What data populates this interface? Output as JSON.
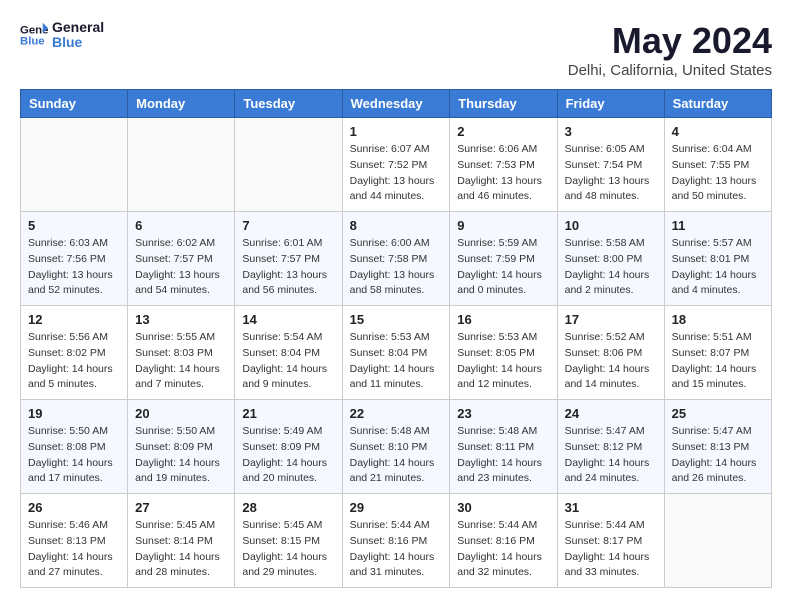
{
  "header": {
    "logo_line1": "General",
    "logo_line2": "Blue",
    "month": "May 2024",
    "location": "Delhi, California, United States"
  },
  "weekdays": [
    "Sunday",
    "Monday",
    "Tuesday",
    "Wednesday",
    "Thursday",
    "Friday",
    "Saturday"
  ],
  "weeks": [
    [
      {
        "day": "",
        "info": ""
      },
      {
        "day": "",
        "info": ""
      },
      {
        "day": "",
        "info": ""
      },
      {
        "day": "1",
        "info": "Sunrise: 6:07 AM\nSunset: 7:52 PM\nDaylight: 13 hours\nand 44 minutes."
      },
      {
        "day": "2",
        "info": "Sunrise: 6:06 AM\nSunset: 7:53 PM\nDaylight: 13 hours\nand 46 minutes."
      },
      {
        "day": "3",
        "info": "Sunrise: 6:05 AM\nSunset: 7:54 PM\nDaylight: 13 hours\nand 48 minutes."
      },
      {
        "day": "4",
        "info": "Sunrise: 6:04 AM\nSunset: 7:55 PM\nDaylight: 13 hours\nand 50 minutes."
      }
    ],
    [
      {
        "day": "5",
        "info": "Sunrise: 6:03 AM\nSunset: 7:56 PM\nDaylight: 13 hours\nand 52 minutes."
      },
      {
        "day": "6",
        "info": "Sunrise: 6:02 AM\nSunset: 7:57 PM\nDaylight: 13 hours\nand 54 minutes."
      },
      {
        "day": "7",
        "info": "Sunrise: 6:01 AM\nSunset: 7:57 PM\nDaylight: 13 hours\nand 56 minutes."
      },
      {
        "day": "8",
        "info": "Sunrise: 6:00 AM\nSunset: 7:58 PM\nDaylight: 13 hours\nand 58 minutes."
      },
      {
        "day": "9",
        "info": "Sunrise: 5:59 AM\nSunset: 7:59 PM\nDaylight: 14 hours\nand 0 minutes."
      },
      {
        "day": "10",
        "info": "Sunrise: 5:58 AM\nSunset: 8:00 PM\nDaylight: 14 hours\nand 2 minutes."
      },
      {
        "day": "11",
        "info": "Sunrise: 5:57 AM\nSunset: 8:01 PM\nDaylight: 14 hours\nand 4 minutes."
      }
    ],
    [
      {
        "day": "12",
        "info": "Sunrise: 5:56 AM\nSunset: 8:02 PM\nDaylight: 14 hours\nand 5 minutes."
      },
      {
        "day": "13",
        "info": "Sunrise: 5:55 AM\nSunset: 8:03 PM\nDaylight: 14 hours\nand 7 minutes."
      },
      {
        "day": "14",
        "info": "Sunrise: 5:54 AM\nSunset: 8:04 PM\nDaylight: 14 hours\nand 9 minutes."
      },
      {
        "day": "15",
        "info": "Sunrise: 5:53 AM\nSunset: 8:04 PM\nDaylight: 14 hours\nand 11 minutes."
      },
      {
        "day": "16",
        "info": "Sunrise: 5:53 AM\nSunset: 8:05 PM\nDaylight: 14 hours\nand 12 minutes."
      },
      {
        "day": "17",
        "info": "Sunrise: 5:52 AM\nSunset: 8:06 PM\nDaylight: 14 hours\nand 14 minutes."
      },
      {
        "day": "18",
        "info": "Sunrise: 5:51 AM\nSunset: 8:07 PM\nDaylight: 14 hours\nand 15 minutes."
      }
    ],
    [
      {
        "day": "19",
        "info": "Sunrise: 5:50 AM\nSunset: 8:08 PM\nDaylight: 14 hours\nand 17 minutes."
      },
      {
        "day": "20",
        "info": "Sunrise: 5:50 AM\nSunset: 8:09 PM\nDaylight: 14 hours\nand 19 minutes."
      },
      {
        "day": "21",
        "info": "Sunrise: 5:49 AM\nSunset: 8:09 PM\nDaylight: 14 hours\nand 20 minutes."
      },
      {
        "day": "22",
        "info": "Sunrise: 5:48 AM\nSunset: 8:10 PM\nDaylight: 14 hours\nand 21 minutes."
      },
      {
        "day": "23",
        "info": "Sunrise: 5:48 AM\nSunset: 8:11 PM\nDaylight: 14 hours\nand 23 minutes."
      },
      {
        "day": "24",
        "info": "Sunrise: 5:47 AM\nSunset: 8:12 PM\nDaylight: 14 hours\nand 24 minutes."
      },
      {
        "day": "25",
        "info": "Sunrise: 5:47 AM\nSunset: 8:13 PM\nDaylight: 14 hours\nand 26 minutes."
      }
    ],
    [
      {
        "day": "26",
        "info": "Sunrise: 5:46 AM\nSunset: 8:13 PM\nDaylight: 14 hours\nand 27 minutes."
      },
      {
        "day": "27",
        "info": "Sunrise: 5:45 AM\nSunset: 8:14 PM\nDaylight: 14 hours\nand 28 minutes."
      },
      {
        "day": "28",
        "info": "Sunrise: 5:45 AM\nSunset: 8:15 PM\nDaylight: 14 hours\nand 29 minutes."
      },
      {
        "day": "29",
        "info": "Sunrise: 5:44 AM\nSunset: 8:16 PM\nDaylight: 14 hours\nand 31 minutes."
      },
      {
        "day": "30",
        "info": "Sunrise: 5:44 AM\nSunset: 8:16 PM\nDaylight: 14 hours\nand 32 minutes."
      },
      {
        "day": "31",
        "info": "Sunrise: 5:44 AM\nSunset: 8:17 PM\nDaylight: 14 hours\nand 33 minutes."
      },
      {
        "day": "",
        "info": ""
      }
    ]
  ]
}
